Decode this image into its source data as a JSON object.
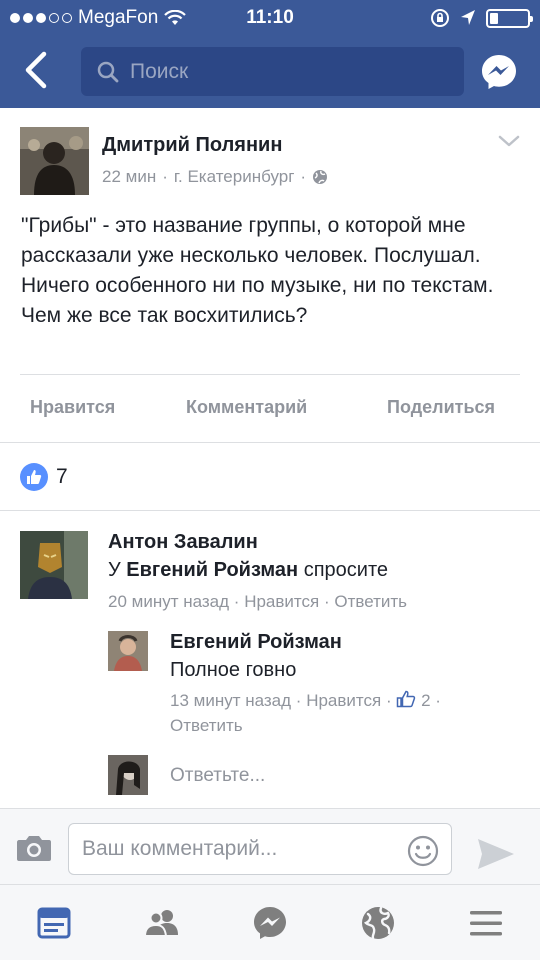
{
  "status_bar": {
    "carrier": "MegaFon",
    "time": "11:10"
  },
  "nav": {
    "search_placeholder": "Поиск"
  },
  "post": {
    "author": "Дмитрий Полянин",
    "time": "22 мин",
    "location": "г. Екатеринбург",
    "text": "\"Грибы\" - это название группы, о которой мне рассказали уже несколько человек. Послушал. Ничего особенного ни по музыке, ни по текстам. Чем же все так восхитились?",
    "actions": {
      "like": "Нравится",
      "comment": "Комментарий",
      "share": "Поделиться"
    },
    "like_count": "7"
  },
  "comments": [
    {
      "author": "Антон Завалин",
      "text_prefix": "У",
      "mention": "Евгений Ройзман",
      "text_suffix": "спросите",
      "time": "20 минут назад",
      "like": "Нравится",
      "reply": "Ответить"
    },
    {
      "author": "Евгений Ройзман",
      "text": "Полное говно",
      "time": "13 минут назад",
      "like": "Нравится",
      "like_count": "2",
      "reply": "Ответить"
    }
  ],
  "reply_placeholder": "Ответьте...",
  "composer": {
    "placeholder": "Ваш комментарий..."
  },
  "colors": {
    "brand": "#3b5998",
    "meta_text": "#90949c",
    "like_blue": "#5890ff"
  },
  "icons": [
    "back-icon",
    "search-icon",
    "messenger-icon",
    "chevron-down-icon",
    "globe-icon",
    "like-icon",
    "camera-icon",
    "smiley-icon",
    "send-icon",
    "news-feed-icon",
    "friends-icon",
    "messenger-tab-icon",
    "notifications-globe-icon",
    "menu-icon"
  ]
}
